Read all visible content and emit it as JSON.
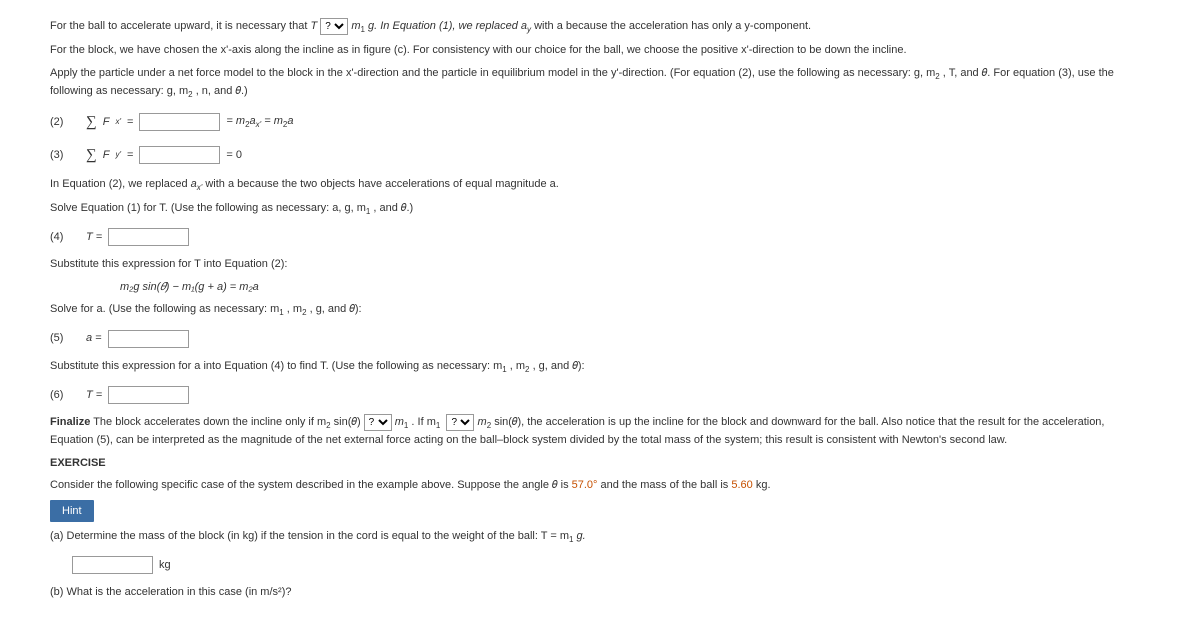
{
  "p1_a": "For the ball to accelerate upward, it is necessary that ",
  "p1_T": "T",
  "p1_sel": "?",
  "p1_b": "m",
  "p1_b2": "1",
  "p1_c": "g. In Equation (1), we replaced ",
  "p1_ay": "a",
  "p1_ay_sub": "y",
  "p1_d": " with a because the acceleration has only a y-component.",
  "p2": "For the block, we have chosen the x'-axis along the incline as in figure (c). For consistency with our choice for the ball, we choose the positive x'-direction to be down the incline.",
  "p3_a": "Apply the particle under a net force model to the block in the x'-direction and the particle in equilibrium model in the y'-direction. (For equation (2), use the following as necessary: g, m",
  "p3_sub2": "2",
  "p3_b": ", T, and 𝜃. For equation (3), use the following as necessary: g, m",
  "p3_c": ", n, and 𝜃.)",
  "eq2_label": "(2)",
  "eq2_sum": "∑",
  "eq2_F": "F",
  "eq2_sub": "x'",
  "eq2_eqs": " = ",
  "eq2_rhs_a": " = m",
  "eq2_rhs_b": "a",
  "eq2_rhs_c": " = m",
  "eq2_rhs_d": "a",
  "eq3_label": "(3)",
  "eq3_sub": "y'",
  "eq3_rhs": " = 0",
  "p4_a": "In Equation (2), we replaced ",
  "p4_ax": "a",
  "p4_ax_sub": "x'",
  "p4_b": " with a because the two objects have accelerations of equal magnitude a.",
  "p5_a": "Solve Equation (1) for T. (Use the following as necessary: a, g, m",
  "p5_sub": "1",
  "p5_b": ", and 𝜃.)",
  "eq4_label": "(4)",
  "eq4_T": "T = ",
  "p6": "Substitute this expression for T into Equation (2):",
  "eq_mid": "m₂g sin(𝜃) − m₁(g + a) = m₂a",
  "p7_a": "Solve for a. (Use the following as necessary: m",
  "p7_b": ", m",
  "p7_c": ", g, and 𝜃):",
  "eq5_label": "(5)",
  "eq5_a": "a = ",
  "p8_a": "Substitute this expression for a into Equation (4) to find T. (Use the following as necessary: m",
  "p8_b": ", m",
  "p8_c": ", g, and 𝜃):",
  "eq6_label": "(6)",
  "eq6_T": "T = ",
  "fin_bold": "Finalize",
  "fin_a": " The block accelerates down the incline only if m",
  "fin_b": " sin(𝜃) ",
  "fin_sel1": "?",
  "fin_c": " m",
  "fin_d": ". If m",
  "fin_sel2": "?",
  "fin_e": " m",
  "fin_f": " sin(𝜃), the acceleration is up the incline for the block and downward for the ball. Also notice that the result for the acceleration, Equation (5), can be interpreted as the magnitude of the net external force acting on the ball–block system divided by the total mass of the system; this result is consistent with Newton's second law.",
  "ex_title": "EXERCISE",
  "ex_p_a": "Consider the following specific case of the system described in the example above. Suppose the angle 𝜃 is ",
  "ex_val1": "57.0°",
  "ex_p_b": " and the mass of the ball is ",
  "ex_val2": "5.60",
  "ex_p_c": " kg.",
  "hint": "Hint",
  "qa_a": "(a)  Determine the mass of the block (in kg) if the tension in the cord is equal to the weight of the ball: T = m",
  "qa_b": "g.",
  "qa_unit": " kg",
  "qb": "(b)  What is the acceleration in this case (in m/s²)?"
}
